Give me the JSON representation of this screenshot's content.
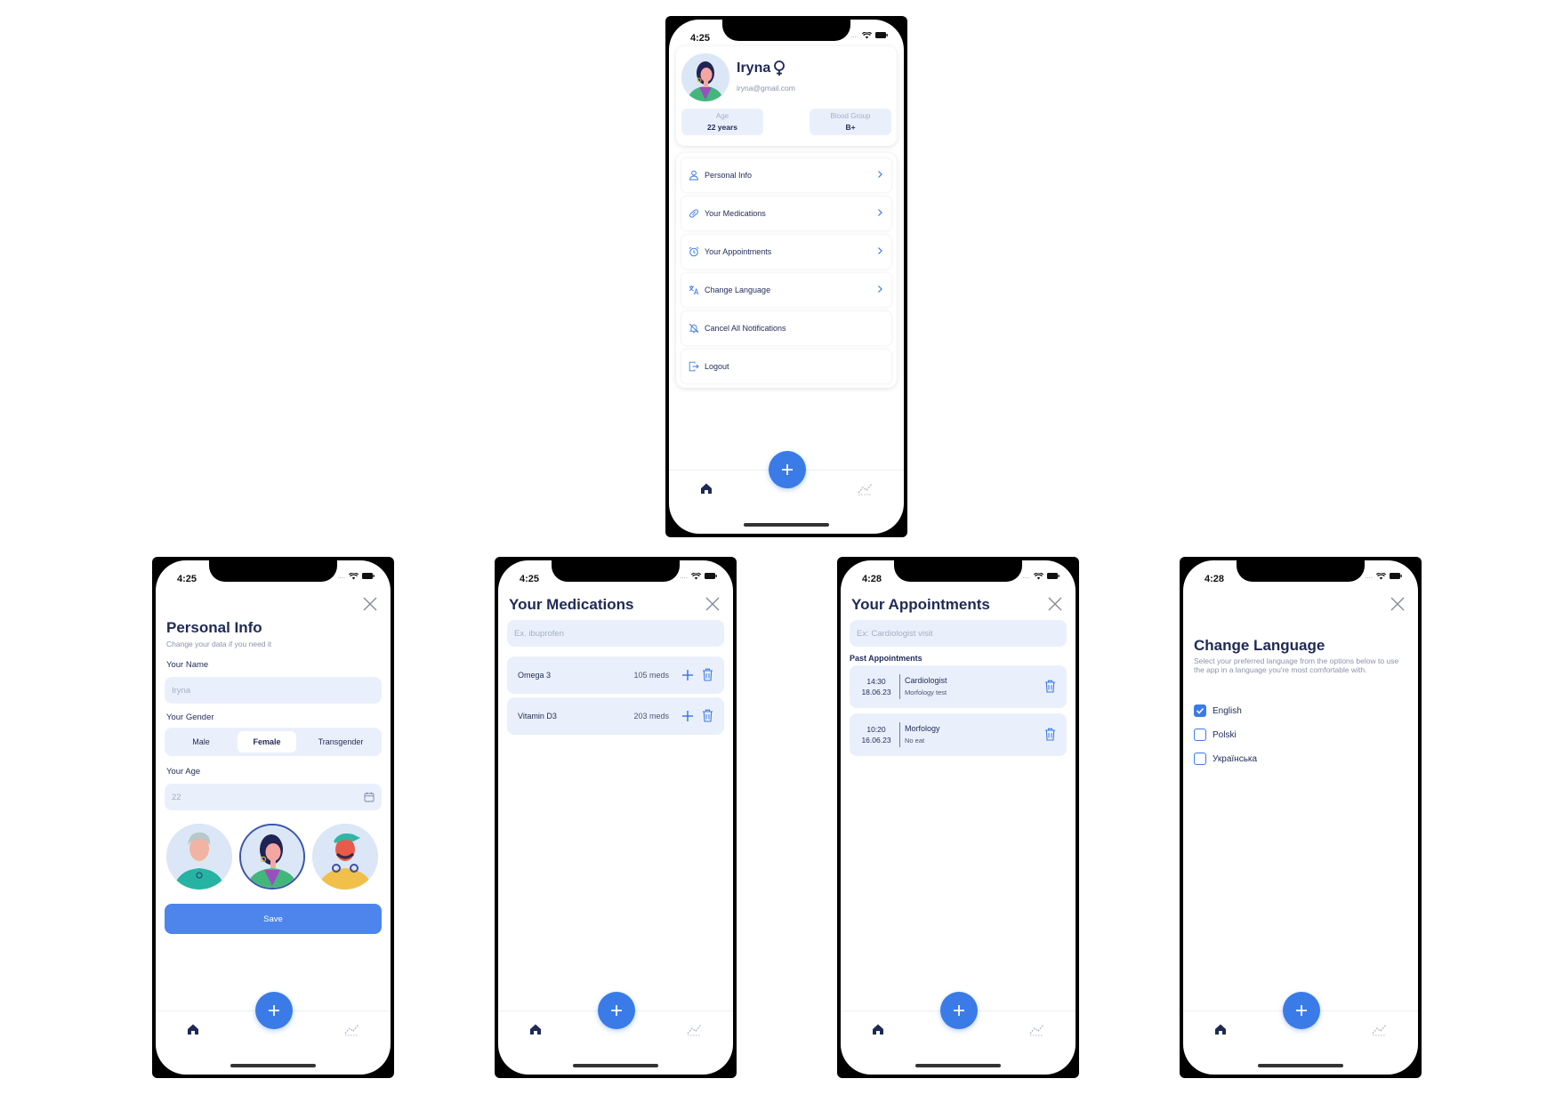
{
  "profile_screen": {
    "time": "4:25",
    "name": "Iryna",
    "email": "iryna@gmail.com",
    "stats": [
      {
        "label": "Age",
        "value": "22 years"
      },
      {
        "label": "Blood Group",
        "value": "B+"
      }
    ],
    "menu": [
      {
        "label": "Personal Info",
        "icon": "user-icon",
        "chevron": true
      },
      {
        "label": "Your Medications",
        "icon": "pill-icon",
        "chevron": true
      },
      {
        "label": "Your Appointments",
        "icon": "alarm-icon",
        "chevron": true
      },
      {
        "label": "Change Language",
        "icon": "translate-icon",
        "chevron": true
      },
      {
        "label": "Cancel All Notifications",
        "icon": "bell-off-icon",
        "chevron": false
      },
      {
        "label": "Logout",
        "icon": "logout-icon",
        "chevron": false
      }
    ]
  },
  "personal_info_screen": {
    "time": "4:25",
    "title": "Personal Info",
    "subtitle": "Change your data if you need it",
    "name_label": "Your Name",
    "name_value": "Iryna",
    "gender_label": "Your Gender",
    "gender_options": [
      "Male",
      "Female",
      "Transgender"
    ],
    "gender_selected": "Female",
    "age_label": "Your Age",
    "age_value": "22",
    "save_label": "Save"
  },
  "medications_screen": {
    "time": "4:25",
    "title": "Your Medications",
    "search_placeholder": "Ex. ibuprofen",
    "items": [
      {
        "name": "Omega 3",
        "count": "105 meds"
      },
      {
        "name": "Vitamin D3",
        "count": "203 meds"
      }
    ]
  },
  "appointments_screen": {
    "time": "4:28",
    "title": "Your Appointments",
    "search_placeholder": "Ex: Cardiologist visit",
    "section": "Past Appointments",
    "items": [
      {
        "time": "14:30",
        "date": "18.06.23",
        "title": "Cardiologist",
        "note": "Morfology test"
      },
      {
        "time": "10:20",
        "date": "16.06.23",
        "title": "Morfology",
        "note": "No eat"
      }
    ]
  },
  "language_screen": {
    "time": "4:28",
    "title": "Change Language",
    "description": "Select your preferred language from the options below to use the app in a language you're most comfortable with.",
    "options": [
      {
        "label": "English",
        "checked": true
      },
      {
        "label": "Polski",
        "checked": false
      },
      {
        "label": "Українська",
        "checked": false
      }
    ]
  },
  "colors": {
    "accent": "#3a7be8",
    "field_bg": "#eaf0fb",
    "title_text": "#1f2a55"
  }
}
